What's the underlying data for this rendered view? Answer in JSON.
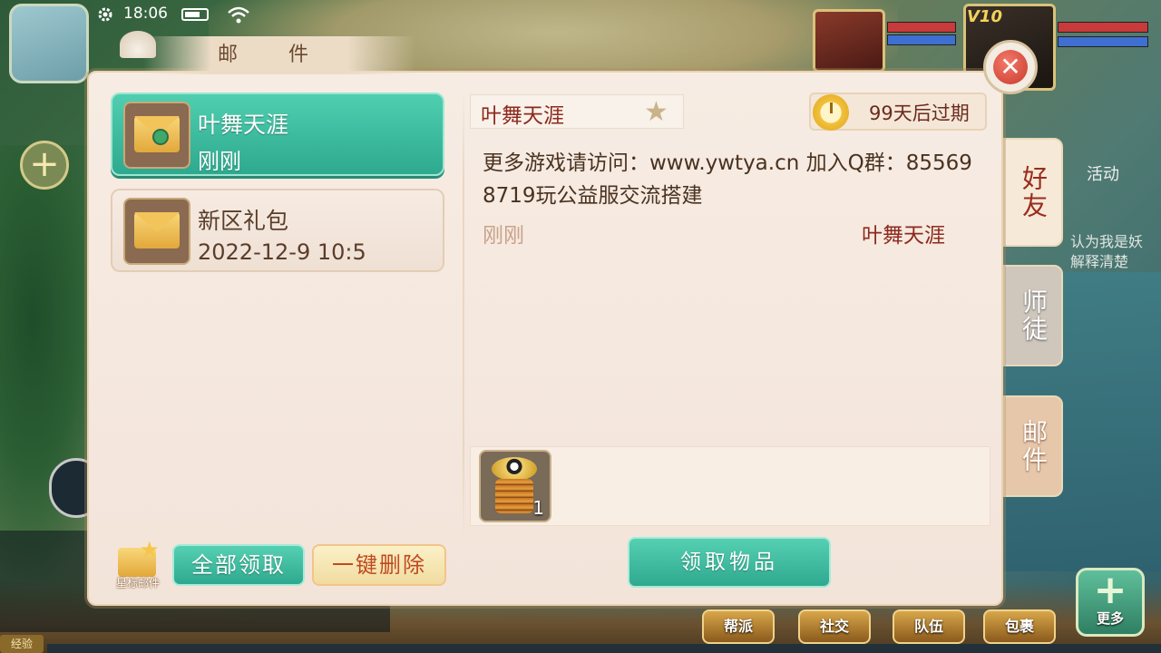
{
  "status_bar": {
    "time": "18:06"
  },
  "panel": {
    "title": "邮件",
    "close_icon": "close-icon",
    "mail_list": [
      {
        "sender": "叶舞天涯",
        "time": "刚刚",
        "selected": true,
        "icon": "envelope-sealed-icon"
      },
      {
        "sender": "新区礼包",
        "time": "2022-12-9 10:5",
        "selected": false,
        "icon": "envelope-open-icon"
      }
    ],
    "star_mail_label": "星标邮件",
    "claim_all_label": "全部领取",
    "delete_all_label": "一键删除"
  },
  "detail": {
    "sender": "叶舞天涯",
    "expire": "99天后过期",
    "body": "更多游戏请访问：www.ywtya.cn  加入Q群：855698719玩公益服交流搭建",
    "time": "刚刚",
    "signature": "叶舞天涯",
    "attachment": {
      "icon": "taiji-spring-item-icon",
      "count": "1"
    },
    "claim_label": "领取物品"
  },
  "side_tabs": [
    {
      "label": "好友",
      "active": true
    },
    {
      "label": "师徒",
      "active": false
    },
    {
      "label": "邮件",
      "active": false
    }
  ],
  "background": {
    "activity_label": "活动",
    "chat_snippet": "认为我是妖\n解释清楚",
    "vip_label": "V10",
    "exp_label": "经验",
    "bottom_buttons": [
      "帮派",
      "社交",
      "队伍",
      "包裹"
    ],
    "more_label": "更多"
  },
  "colors": {
    "accent_teal": "#2ea98f",
    "sender_red": "#8e2a1e",
    "panel_bg": "#f5e8de"
  }
}
